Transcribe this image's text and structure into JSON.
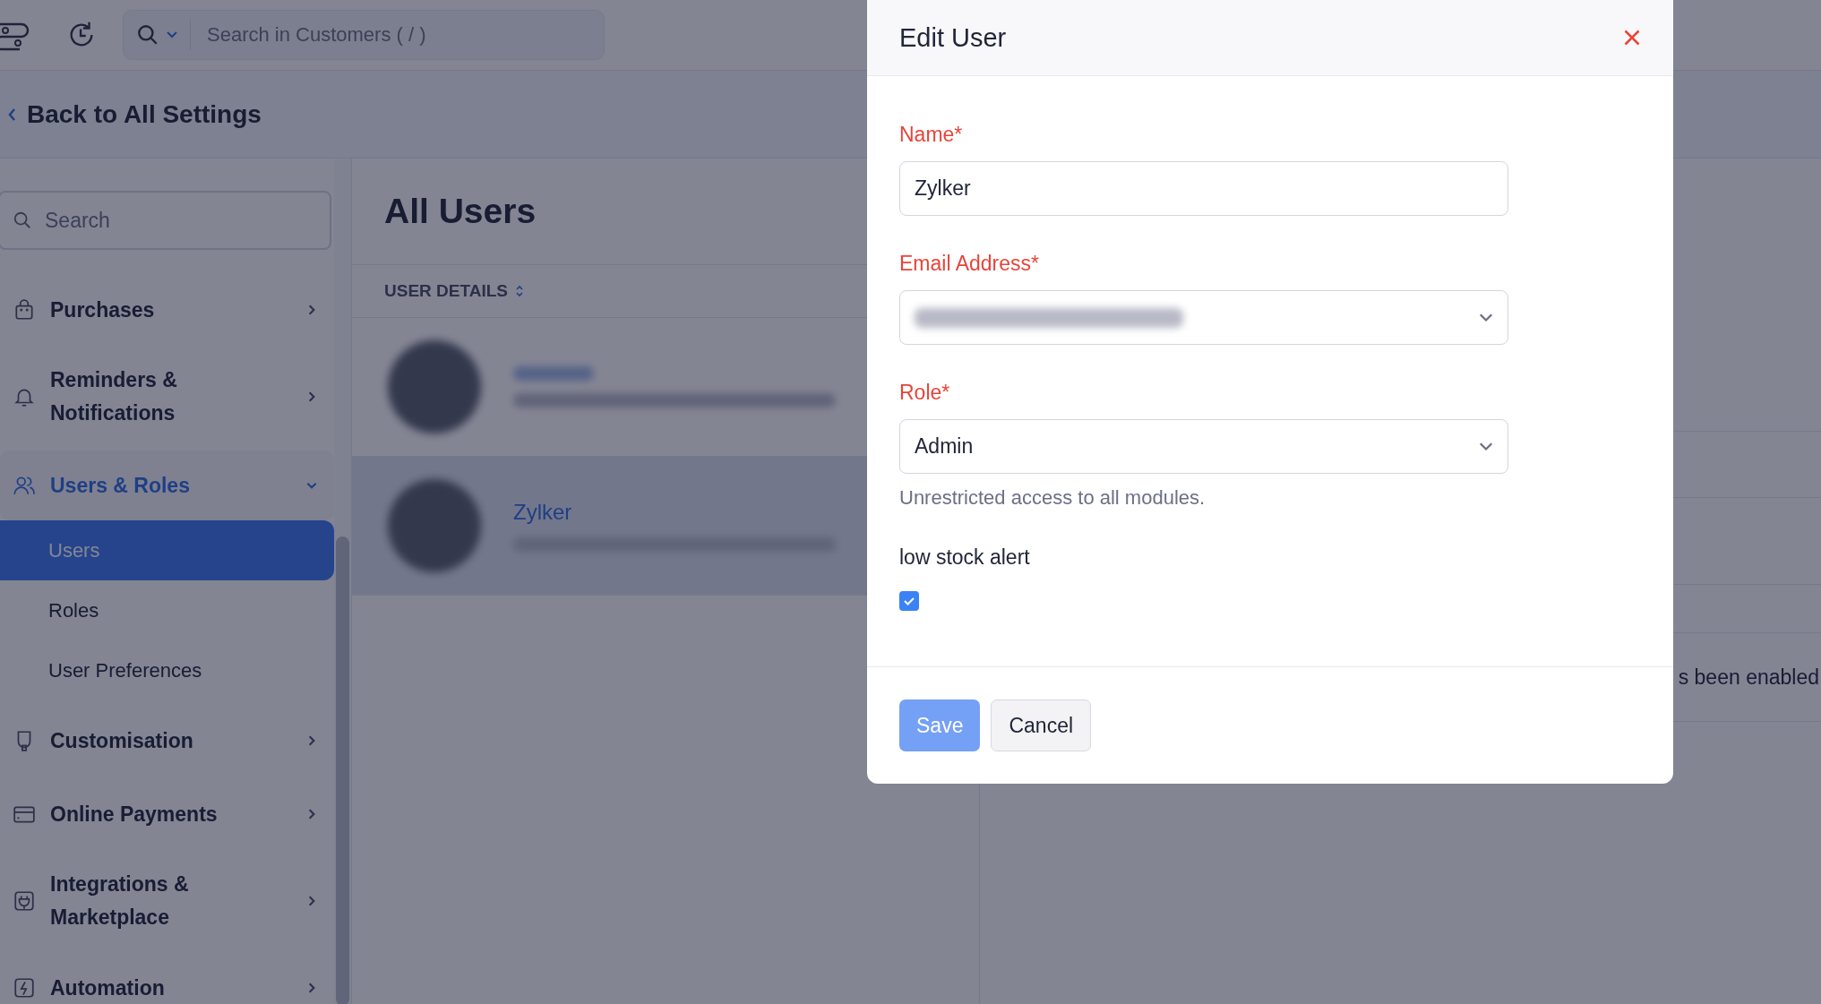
{
  "topbar": {
    "search": {
      "placeholder": "Search in Customers ( / )"
    }
  },
  "back_link": "Back to All Settings",
  "sidebar": {
    "search": {
      "placeholder": "Search"
    },
    "items": [
      {
        "label": "Purchases",
        "expanded": false
      },
      {
        "label": "Reminders & Notifications",
        "expanded": false
      },
      {
        "label": "Users & Roles",
        "expanded": true,
        "children": [
          {
            "label": "Users",
            "selected": true
          },
          {
            "label": "Roles",
            "selected": false
          },
          {
            "label": "User Preferences",
            "selected": false
          }
        ]
      },
      {
        "label": "Customisation",
        "expanded": false
      },
      {
        "label": "Online Payments",
        "expanded": false
      },
      {
        "label": "Integrations & Marketplace",
        "expanded": false
      },
      {
        "label": "Automation",
        "expanded": false
      }
    ]
  },
  "main": {
    "title": "All Users",
    "column": "USER DETAILS",
    "rows": [
      {
        "selected": false
      },
      {
        "name": "Zylker",
        "selected": true
      }
    ]
  },
  "detail_panel": {
    "text": "s been enabled"
  },
  "modal": {
    "title": "Edit User",
    "fields": [
      {
        "kind": "text",
        "label": "Name*",
        "value": "Zylker",
        "redacted": false
      },
      {
        "kind": "select",
        "label": "Email Address*",
        "redacted": true
      },
      {
        "kind": "select",
        "label": "Role*",
        "value": "Admin",
        "redacted": false,
        "hint": "Unrestricted access to all modules."
      },
      {
        "kind": "checkbox",
        "label": "low stock alert",
        "checked": true
      }
    ],
    "buttons": [
      {
        "label": "Save",
        "kind": "primary"
      },
      {
        "label": "Cancel",
        "kind": "secondary"
      }
    ]
  }
}
